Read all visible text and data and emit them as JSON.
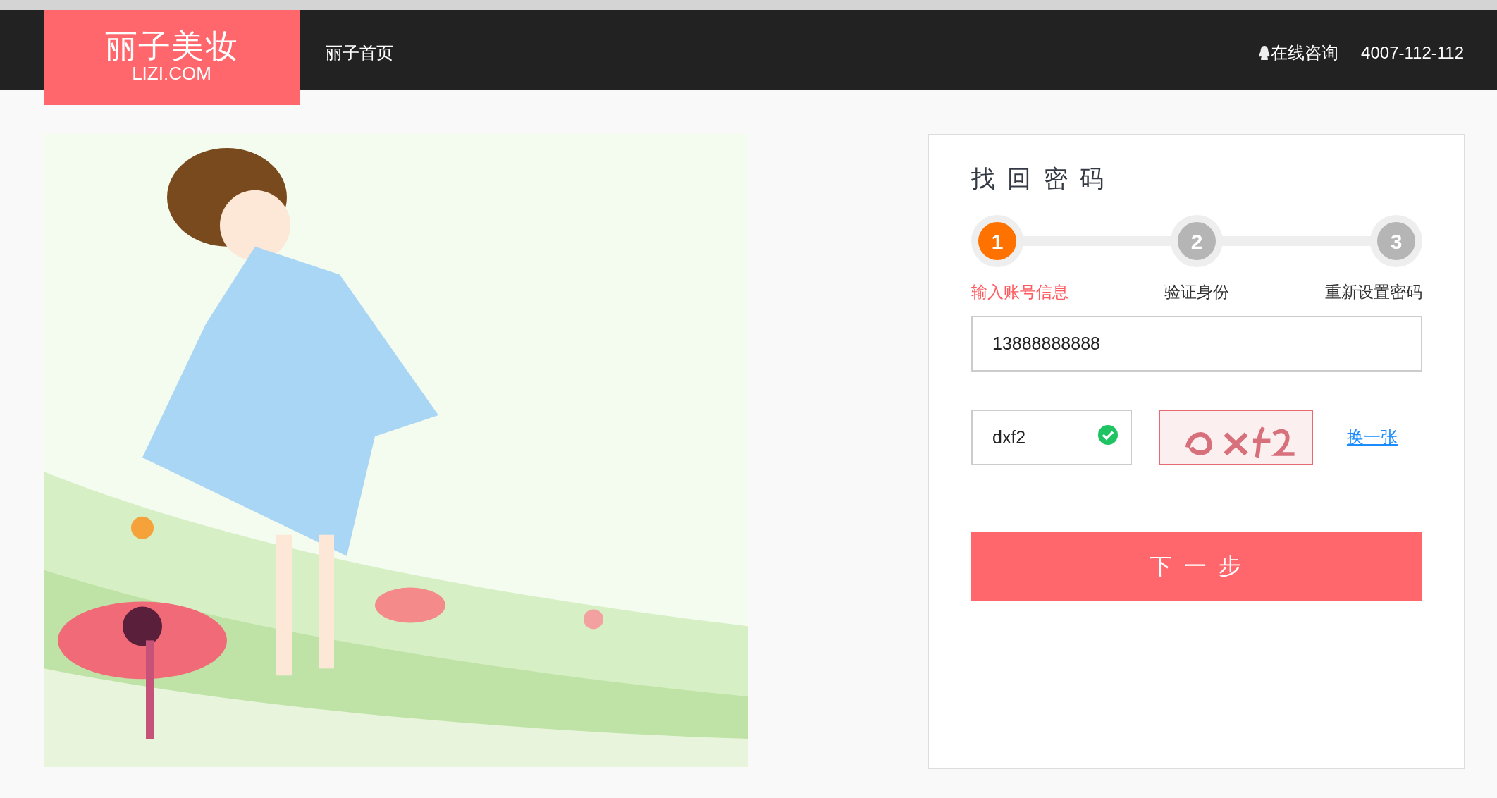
{
  "header": {
    "logo": {
      "name": "丽子美妆",
      "domain": "LIZI.COM"
    },
    "nav": [
      {
        "label": "丽子首页"
      }
    ],
    "consult": "在线咨询",
    "phone": "4007-112-112"
  },
  "form": {
    "title": "找 回 密 码",
    "steps": [
      {
        "number": "1",
        "label": "输入账号信息",
        "selected": true
      },
      {
        "number": "2",
        "label": "验证身份",
        "selected": false
      },
      {
        "number": "3",
        "label": "重新设置密码",
        "selected": false
      }
    ],
    "account": {
      "value": "13888888888"
    },
    "captcha": {
      "value": "dxf2",
      "verified": true
    },
    "refresh_link": "换一张",
    "submit": "下 一 步"
  }
}
